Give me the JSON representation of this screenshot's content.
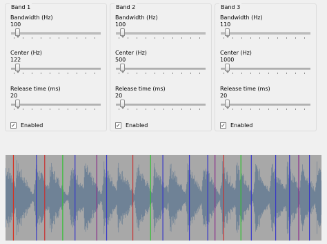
{
  "bands": [
    {
      "title": "Band 1",
      "bandwidth": {
        "label": "Bandwidth (Hz)",
        "value": "100",
        "fraction": 0.02
      },
      "center": {
        "label": "Center (Hz)",
        "value": "122",
        "fraction": 0.02
      },
      "release": {
        "label": "Release time (ms)",
        "value": "20",
        "fraction": 0.02
      },
      "enabled": {
        "label": "Enabled",
        "checked": true
      }
    },
    {
      "title": "Band 2",
      "bandwidth": {
        "label": "Bandwidth (Hz)",
        "value": "100",
        "fraction": 0.02
      },
      "center": {
        "label": "Center (Hz)",
        "value": "500",
        "fraction": 0.02
      },
      "release": {
        "label": "Release time (ms)",
        "value": "20",
        "fraction": 0.02
      },
      "enabled": {
        "label": "Enabled",
        "checked": true
      }
    },
    {
      "title": "Band 3",
      "bandwidth": {
        "label": "Bandwidth (Hz)",
        "value": "110",
        "fraction": 0.02
      },
      "center": {
        "label": "Center (Hz)",
        "value": "1000",
        "fraction": 0.02
      },
      "release": {
        "label": "Release time (ms)",
        "value": "20",
        "fraction": 0.02
      },
      "enabled": {
        "label": "Enabled",
        "checked": true
      }
    }
  ],
  "waveform": {
    "background": "#a8a8a8",
    "wave_color": "#6f8296",
    "markers": [
      {
        "position": 0.025,
        "color": "#d83020"
      },
      {
        "position": 0.098,
        "color": "#3838c8"
      },
      {
        "position": 0.124,
        "color": "#c83030"
      },
      {
        "position": 0.181,
        "color": "#30c030"
      },
      {
        "position": 0.22,
        "color": "#3838c8"
      },
      {
        "position": 0.289,
        "color": "#8a2a8a"
      },
      {
        "position": 0.32,
        "color": "#3838c8"
      },
      {
        "position": 0.403,
        "color": "#c83030"
      },
      {
        "position": 0.459,
        "color": "#30c030"
      },
      {
        "position": 0.498,
        "color": "#3838c8"
      },
      {
        "position": 0.582,
        "color": "#3838c8"
      },
      {
        "position": 0.64,
        "color": "#3838c8"
      },
      {
        "position": 0.663,
        "color": "#8a2a8a"
      },
      {
        "position": 0.69,
        "color": "#c83030"
      },
      {
        "position": 0.745,
        "color": "#30c030"
      },
      {
        "position": 0.778,
        "color": "#3838c8"
      },
      {
        "position": 0.855,
        "color": "#3838c8"
      },
      {
        "position": 0.899,
        "color": "#3838c8"
      },
      {
        "position": 0.928,
        "color": "#8a2a8a"
      },
      {
        "position": 0.962,
        "color": "#3838c8"
      }
    ]
  }
}
